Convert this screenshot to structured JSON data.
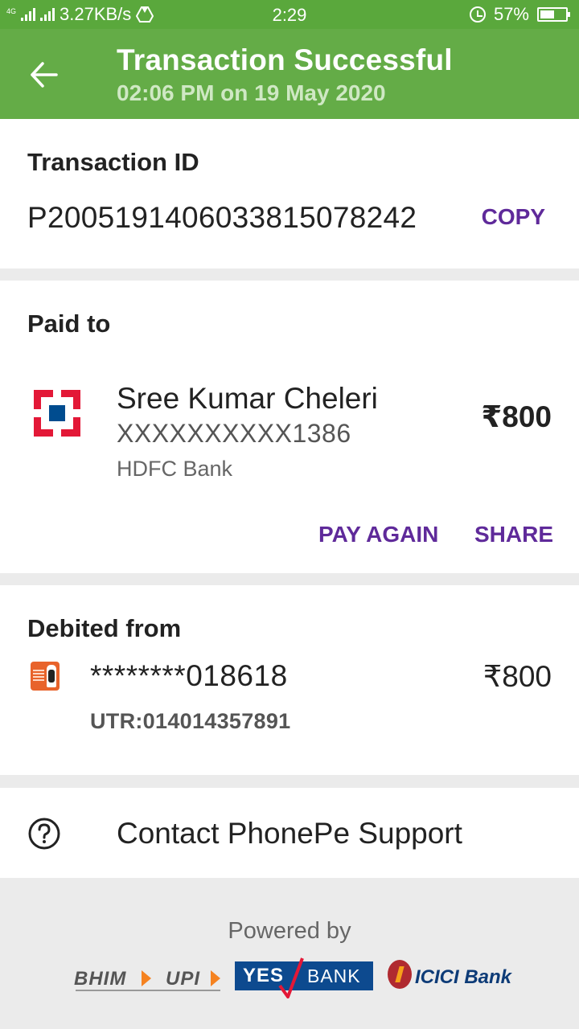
{
  "status_bar": {
    "network": "4G",
    "speed": "3.27KB/s",
    "time": "2:29",
    "battery": "57%",
    "battery_level": 0.57
  },
  "app_bar": {
    "title": "Transaction Successful",
    "subtitle": "02:06 PM on 19 May 2020",
    "back_icon": "back-arrow-icon",
    "color": "#64ac47"
  },
  "transaction": {
    "label": "Transaction ID",
    "id": "P2005191406033815078242",
    "copy_label": "COPY"
  },
  "paid_to": {
    "label": "Paid to",
    "name": "Sree Kumar Cheleri",
    "account": "XXXXXXXXXX1386",
    "bank": "HDFC Bank",
    "amount": "₹800",
    "pay_again_label": "PAY AGAIN",
    "share_label": "SHARE",
    "logo_icon": "hdfc-bank-logo"
  },
  "debited_from": {
    "label": "Debited from",
    "account": "********018618",
    "amount": "₹800",
    "utr": "UTR:014014357891",
    "logo_icon": "bank-logo"
  },
  "support": {
    "label": "Contact PhonePe Support",
    "icon": "help-circle-icon"
  },
  "footer": {
    "powered_by": "Powered by",
    "logos": {
      "bhim": "BHIM",
      "upi": "UPI",
      "yes": "YES",
      "yes_bank": "BANK",
      "icici": "ICICI Bank"
    }
  },
  "colors": {
    "accent": "#5f2a9a",
    "header_green": "#64ac47",
    "status_green": "#5aa83c"
  }
}
